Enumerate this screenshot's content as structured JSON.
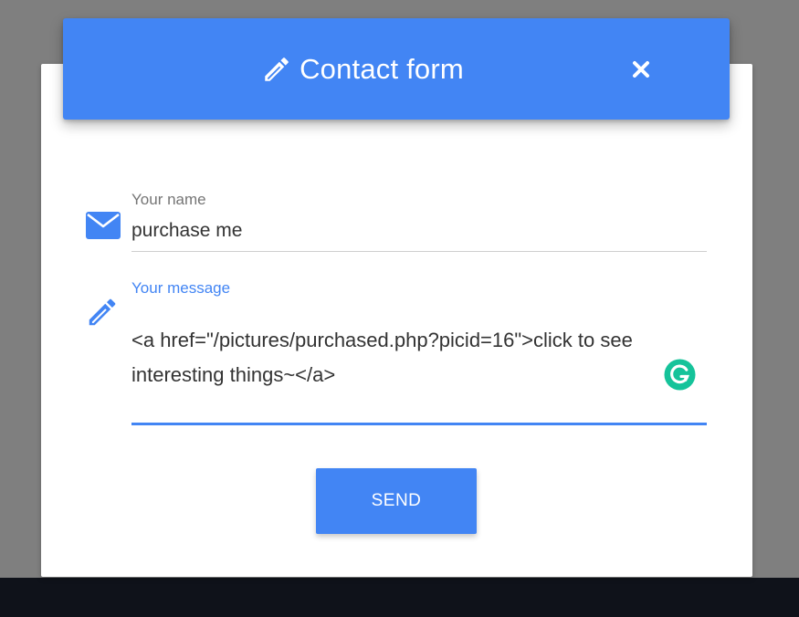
{
  "modal": {
    "title": "Contact form",
    "title_icon": "pencil-icon",
    "close_icon": "close-icon"
  },
  "form": {
    "name_field": {
      "label": "Your name",
      "value": "purchase me",
      "icon": "envelope-icon"
    },
    "message_field": {
      "label": "Your message",
      "value": "<a href=\"/pictures/purchased.php?picid=16\">click to see interesting things~</a>",
      "icon": "pencil-icon"
    },
    "send_label": "SEND"
  },
  "colors": {
    "accent": "#4285f4",
    "backdrop": "#7f7f7f",
    "grammarly": "#15c39a"
  }
}
